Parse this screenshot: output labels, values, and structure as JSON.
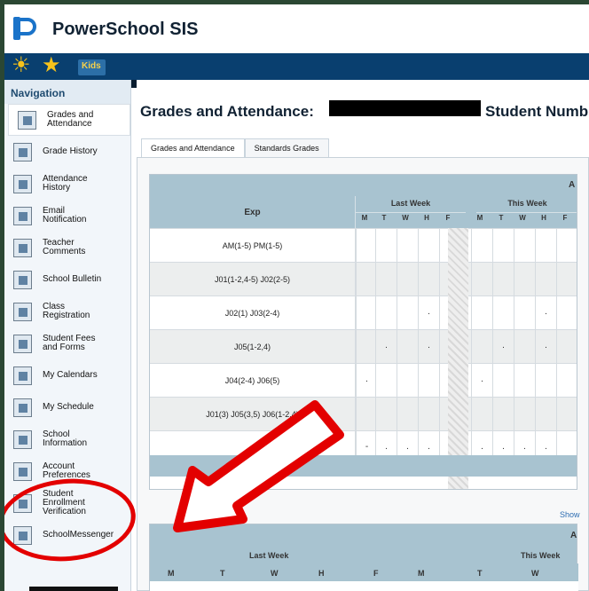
{
  "app": {
    "title": "PowerSchool SIS",
    "kids_label": "Kids"
  },
  "sidebar": {
    "title": "Navigation",
    "items": [
      {
        "label": "Grades and\nAttendance",
        "icon": "grades-icon"
      },
      {
        "label": "Grade History",
        "icon": "history-icon"
      },
      {
        "label": "Attendance\nHistory",
        "icon": "attendance-icon"
      },
      {
        "label": "Email\nNotification",
        "icon": "email-icon"
      },
      {
        "label": "Teacher\nComments",
        "icon": "comments-icon"
      },
      {
        "label": "School Bulletin",
        "icon": "bulletin-icon"
      },
      {
        "label": "Class\nRegistration",
        "icon": "registration-icon"
      },
      {
        "label": "Student Fees\nand Forms",
        "icon": "fees-icon"
      },
      {
        "label": "My Calendars",
        "icon": "calendar-icon"
      },
      {
        "label": "My Schedule",
        "icon": "schedule-icon"
      },
      {
        "label": "School\nInformation",
        "icon": "school-icon"
      },
      {
        "label": "Account\nPreferences",
        "icon": "preferences-icon"
      },
      {
        "label": "Student\nEnrollment\nVerification",
        "icon": "enrollment-icon"
      },
      {
        "label": "SchoolMessenger",
        "icon": "messenger-icon"
      }
    ]
  },
  "main": {
    "title_prefix": "Grades and Attendance:",
    "title_suffix": "Student Numb",
    "tabs": [
      {
        "label": "Grades and Attendance"
      },
      {
        "label": "Standards Grades"
      }
    ],
    "table": {
      "top_label": "A",
      "exp_header": "Exp",
      "week_headers": [
        "Last Week",
        "This Week"
      ],
      "days": [
        "M",
        "T",
        "W",
        "H",
        "F",
        "M",
        "T",
        "W",
        "H",
        "F"
      ],
      "rows": [
        {
          "exp": "AM(1-5) PM(1-5)",
          "marks": [
            "",
            "",
            "",
            "",
            "",
            "",
            "",
            "",
            "",
            ""
          ]
        },
        {
          "exp": "J01(1-2,4-5) J02(2-5)",
          "marks": [
            "",
            "",
            "",
            "",
            "",
            "",
            "",
            "",
            "",
            ""
          ]
        },
        {
          "exp": "J02(1) J03(2-4)",
          "marks": [
            "",
            "",
            "",
            ".",
            "",
            "",
            "",
            "",
            ".",
            ""
          ]
        },
        {
          "exp": "J05(1-2,4)",
          "marks": [
            "",
            ".",
            "",
            ".",
            "",
            "",
            ".",
            "",
            ".",
            ""
          ]
        },
        {
          "exp": "J04(2-4) J06(5)",
          "marks": [
            ".",
            "",
            "",
            "",
            "",
            ".",
            "",
            "",
            "",
            ""
          ]
        },
        {
          "exp": "J01(3) J05(3,5) J06(1-2,4)",
          "marks": [
            "",
            "",
            "",
            "",
            "",
            "",
            "",
            "",
            "",
            ""
          ]
        },
        {
          "exp": "",
          "marks": [
            "-",
            ".",
            ".",
            ".",
            "",
            ".",
            ".",
            ".",
            ".",
            ""
          ]
        }
      ]
    },
    "show_link": "Show",
    "table2": {
      "top_label": "A",
      "week_headers": [
        "Last Week",
        "This Week"
      ],
      "days": [
        "M",
        "T",
        "W",
        "H",
        "F",
        "M",
        "T",
        "W"
      ]
    }
  },
  "annotations": {
    "arrow_color": "#e30000",
    "oval_color": "#e30000"
  }
}
